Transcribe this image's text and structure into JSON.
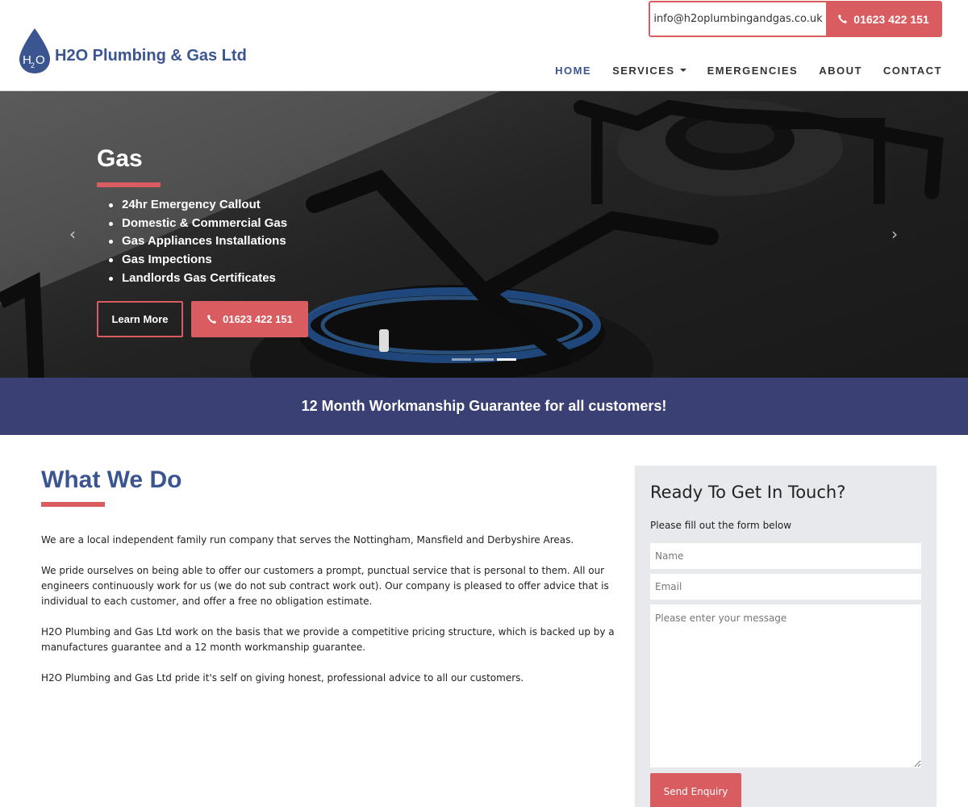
{
  "header": {
    "logo_text": "H2O Plumbing & Gas Ltd",
    "logo_mark": "H2O",
    "email": "info@h2oplumbingandgas.co.uk",
    "phone": "01623 422 151"
  },
  "nav": {
    "items": [
      {
        "label": "HOME",
        "active": true
      },
      {
        "label": "SERVICES",
        "dropdown": true
      },
      {
        "label": "EMERGENCIES"
      },
      {
        "label": "ABOUT"
      },
      {
        "label": "CONTACT"
      }
    ]
  },
  "hero": {
    "title": "Gas",
    "list": [
      "24hr Emergency Callout",
      "Domestic & Commercial Gas",
      "Gas Appliances Installations",
      "Gas Impections",
      "Landlords Gas Certificates"
    ],
    "learn_more": "Learn More",
    "phone": "01623 422 151",
    "slides": 3,
    "active_slide": 3
  },
  "band": {
    "text": "12 Month Workmanship Guarantee for all customers!"
  },
  "what_we_do": {
    "title": "What We Do",
    "paragraphs": [
      "We are a local independent family run company that serves the Nottingham, Mansfield and Derbyshire Areas.",
      "We pride ourselves on being able to offer our customers a prompt, punctual service that is personal to them. All our engineers continuously work for us (we do not sub contract work out). Our company is pleased to offer advice that is individual to each customer, and offer a free no obligation estimate.",
      "H2O Plumbing and Gas Ltd work on the basis that we provide a competitive pricing structure, which is backed up by a manufactures guarantee and a 12 month workmanship guarantee.",
      "H2O Plumbing and Gas Ltd pride it's self on giving honest, professional advice to all our customers."
    ]
  },
  "form": {
    "title": "Ready To Get In Touch?",
    "subtitle": "Please fill out the form below",
    "name_placeholder": "Name",
    "email_placeholder": "Email",
    "message_placeholder": "Please enter your message",
    "submit": "Send Enquiry"
  },
  "colors": {
    "brand_blue": "#3b5591",
    "accent_red": "#d95c60",
    "band_navy": "#3a3f74",
    "form_bg": "#e8e9ed"
  }
}
